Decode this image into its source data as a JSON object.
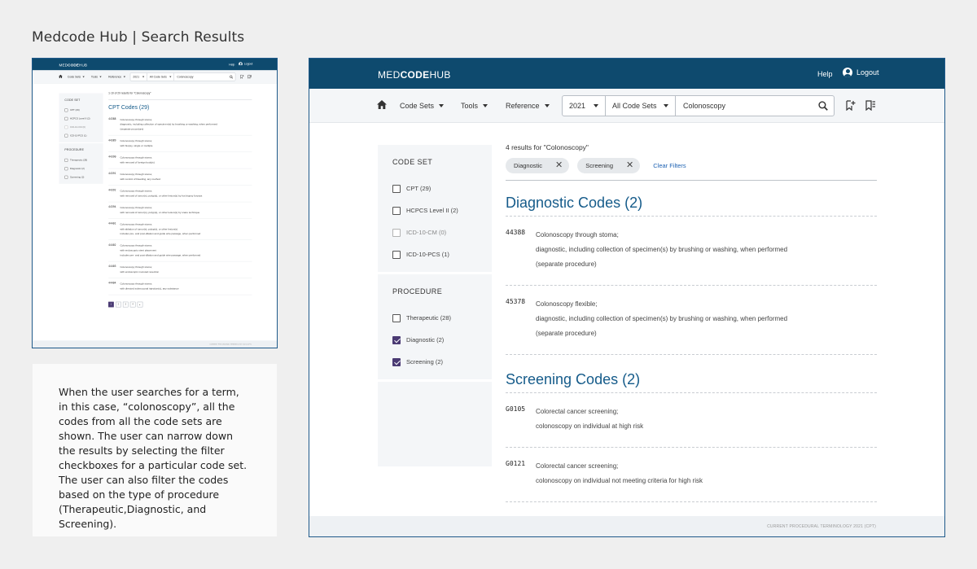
{
  "page": {
    "heading": "Medcode Hub | Search Results"
  },
  "description": "When the user searches for a term, in this case, “colonoscopy”, all the codes from all the code sets are shown. The user can narrow down the results by selecting the filter checkboxes for a particular code set. The user can also filter the codes based on the type of procedure (Therapeutic,Diagnostic, and Screening).",
  "app": {
    "logo": {
      "part1": "MED",
      "part2": "CODE",
      "part3": "HUB"
    },
    "header": {
      "help": "Help",
      "logout": "Logout"
    },
    "nav": {
      "code_sets": "Code Sets",
      "tools": "Tools",
      "reference": "Reference",
      "year": "2021",
      "code_set_filter": "All Code Sets",
      "search_value": "Colonoscopy"
    },
    "filters": {
      "code_set_title": "CODE SET",
      "code_set_items": [
        {
          "label": "CPT (29)",
          "checked": false,
          "disabled": false
        },
        {
          "label": "HCPCS Level II (2)",
          "checked": false,
          "disabled": false
        },
        {
          "label": "ICD-10-CM (0)",
          "checked": false,
          "disabled": true
        },
        {
          "label": "ICD-10-PCS (1)",
          "checked": false,
          "disabled": false
        }
      ],
      "procedure_title": "PROCEDURE",
      "procedure_items": [
        {
          "label": "Therapeutic (28)",
          "checked": false
        },
        {
          "label": "Diagnostic (2)",
          "checked": true
        },
        {
          "label": "Screening (2)",
          "checked": true
        }
      ]
    },
    "results": {
      "count_text": "4 results for \"Colonoscopy\"",
      "chips": [
        "Diagnostic",
        "Screening"
      ],
      "clear_filters": "Clear Filters",
      "sections": [
        {
          "title": "Diagnostic Codes (2)",
          "codes": [
            {
              "code": "44388",
              "lines": [
                "Colonoscopy through stoma;",
                "diagnostic, including collection of specimen(s) by brushing or washing, when performed",
                "(separate procedure)"
              ]
            },
            {
              "code": "45378",
              "lines": [
                "Colonoscopy flexible;",
                "diagnostic, including collection of specimen(s) by brushing or washing, when performed",
                "(separate procedure)"
              ]
            }
          ]
        },
        {
          "title": "Screening Codes (2)",
          "codes": [
            {
              "code": "G0105",
              "lines": [
                "Colorectal cancer screening;",
                "colonoscopy on individual at high risk"
              ]
            },
            {
              "code": "G0121",
              "lines": [
                "Colorectal cancer screening;",
                "colonoscopy on individual not meeting criteria for high risk"
              ]
            }
          ]
        }
      ]
    },
    "footer": "CURRENT PROCEDURAL TERMINOLOGY 2021 (CPT)"
  },
  "thumbnail": {
    "count_text": "1-10 of 29 results for \"Colonoscopy\"",
    "section_title": "CPT Codes (29)",
    "filters": {
      "code_set_title": "CODE SET",
      "code_set_items": [
        "CPT (29)",
        "HCPCS Level II (2)",
        "ICD-10-CM (0)",
        "ICD-10-PCS (1)"
      ],
      "procedure_title": "PROCEDURE",
      "procedure_items": [
        "Therapeutic (28)",
        "Diagnostic (2)",
        "Screening (2)"
      ]
    },
    "codes": [
      {
        "code": "44388",
        "lines": [
          "Colonoscopy through stoma;",
          "diagnostic, including collection of specimen(s) by brushing or washing, when performed",
          "(separate procedure)"
        ]
      },
      {
        "code": "44389",
        "lines": [
          "Colonoscopy through stoma;",
          "with biopsy, single or multiple"
        ]
      },
      {
        "code": "44390",
        "lines": [
          "Colonoscopy through stoma;",
          "with removal of foreign body(s)"
        ]
      },
      {
        "code": "44391",
        "lines": [
          "Colonoscopy through stoma;",
          "with control of bleeding, any method"
        ]
      },
      {
        "code": "44392",
        "lines": [
          "Colonoscopy through stoma;",
          "with removal of tumor(s), polyp(s), or other lesion(s) by hot biopsy forceps"
        ]
      },
      {
        "code": "44394",
        "lines": [
          "Colonoscopy through stoma;",
          "with removal of tumor(s), polyp(s), or other lesion(s) by snare technique"
        ]
      },
      {
        "code": "44401",
        "lines": [
          "Colonoscopy through stoma;",
          "with ablation of tumor(s), polyp(s), or other lesion(s)",
          "includes pre- and post-dilation and guide wire passage, when performed"
        ]
      },
      {
        "code": "44402",
        "lines": [
          "Colonoscopy through stoma;",
          "with endoscopic stent placement",
          "includes pre- and post-dilation and guide wire passage, when performed"
        ]
      },
      {
        "code": "44403",
        "lines": [
          "Colonoscopy through stoma;",
          "with endoscopic mucosal resection"
        ]
      },
      {
        "code": "44404",
        "lines": [
          "Colonoscopy through stoma;",
          "with directed submucosal injection(s), any substance"
        ]
      }
    ],
    "pages": [
      "1",
      "2",
      "3",
      "4",
      "▸"
    ],
    "footer": "CURRENT PROCEDURAL TERMINOLOGY 2021 (CPT)"
  },
  "icons": {
    "home": "home-icon",
    "search": "search-icon",
    "bookmark_add": "bookmark-add-icon",
    "bookmark_list": "bookmark-list-icon",
    "user": "user-icon",
    "close": "close-icon"
  },
  "colors": {
    "header": "#0e4a6e",
    "accent_text": "#155b8a",
    "checkbox_checked": "#4a3a73",
    "link": "#1f63b3"
  }
}
